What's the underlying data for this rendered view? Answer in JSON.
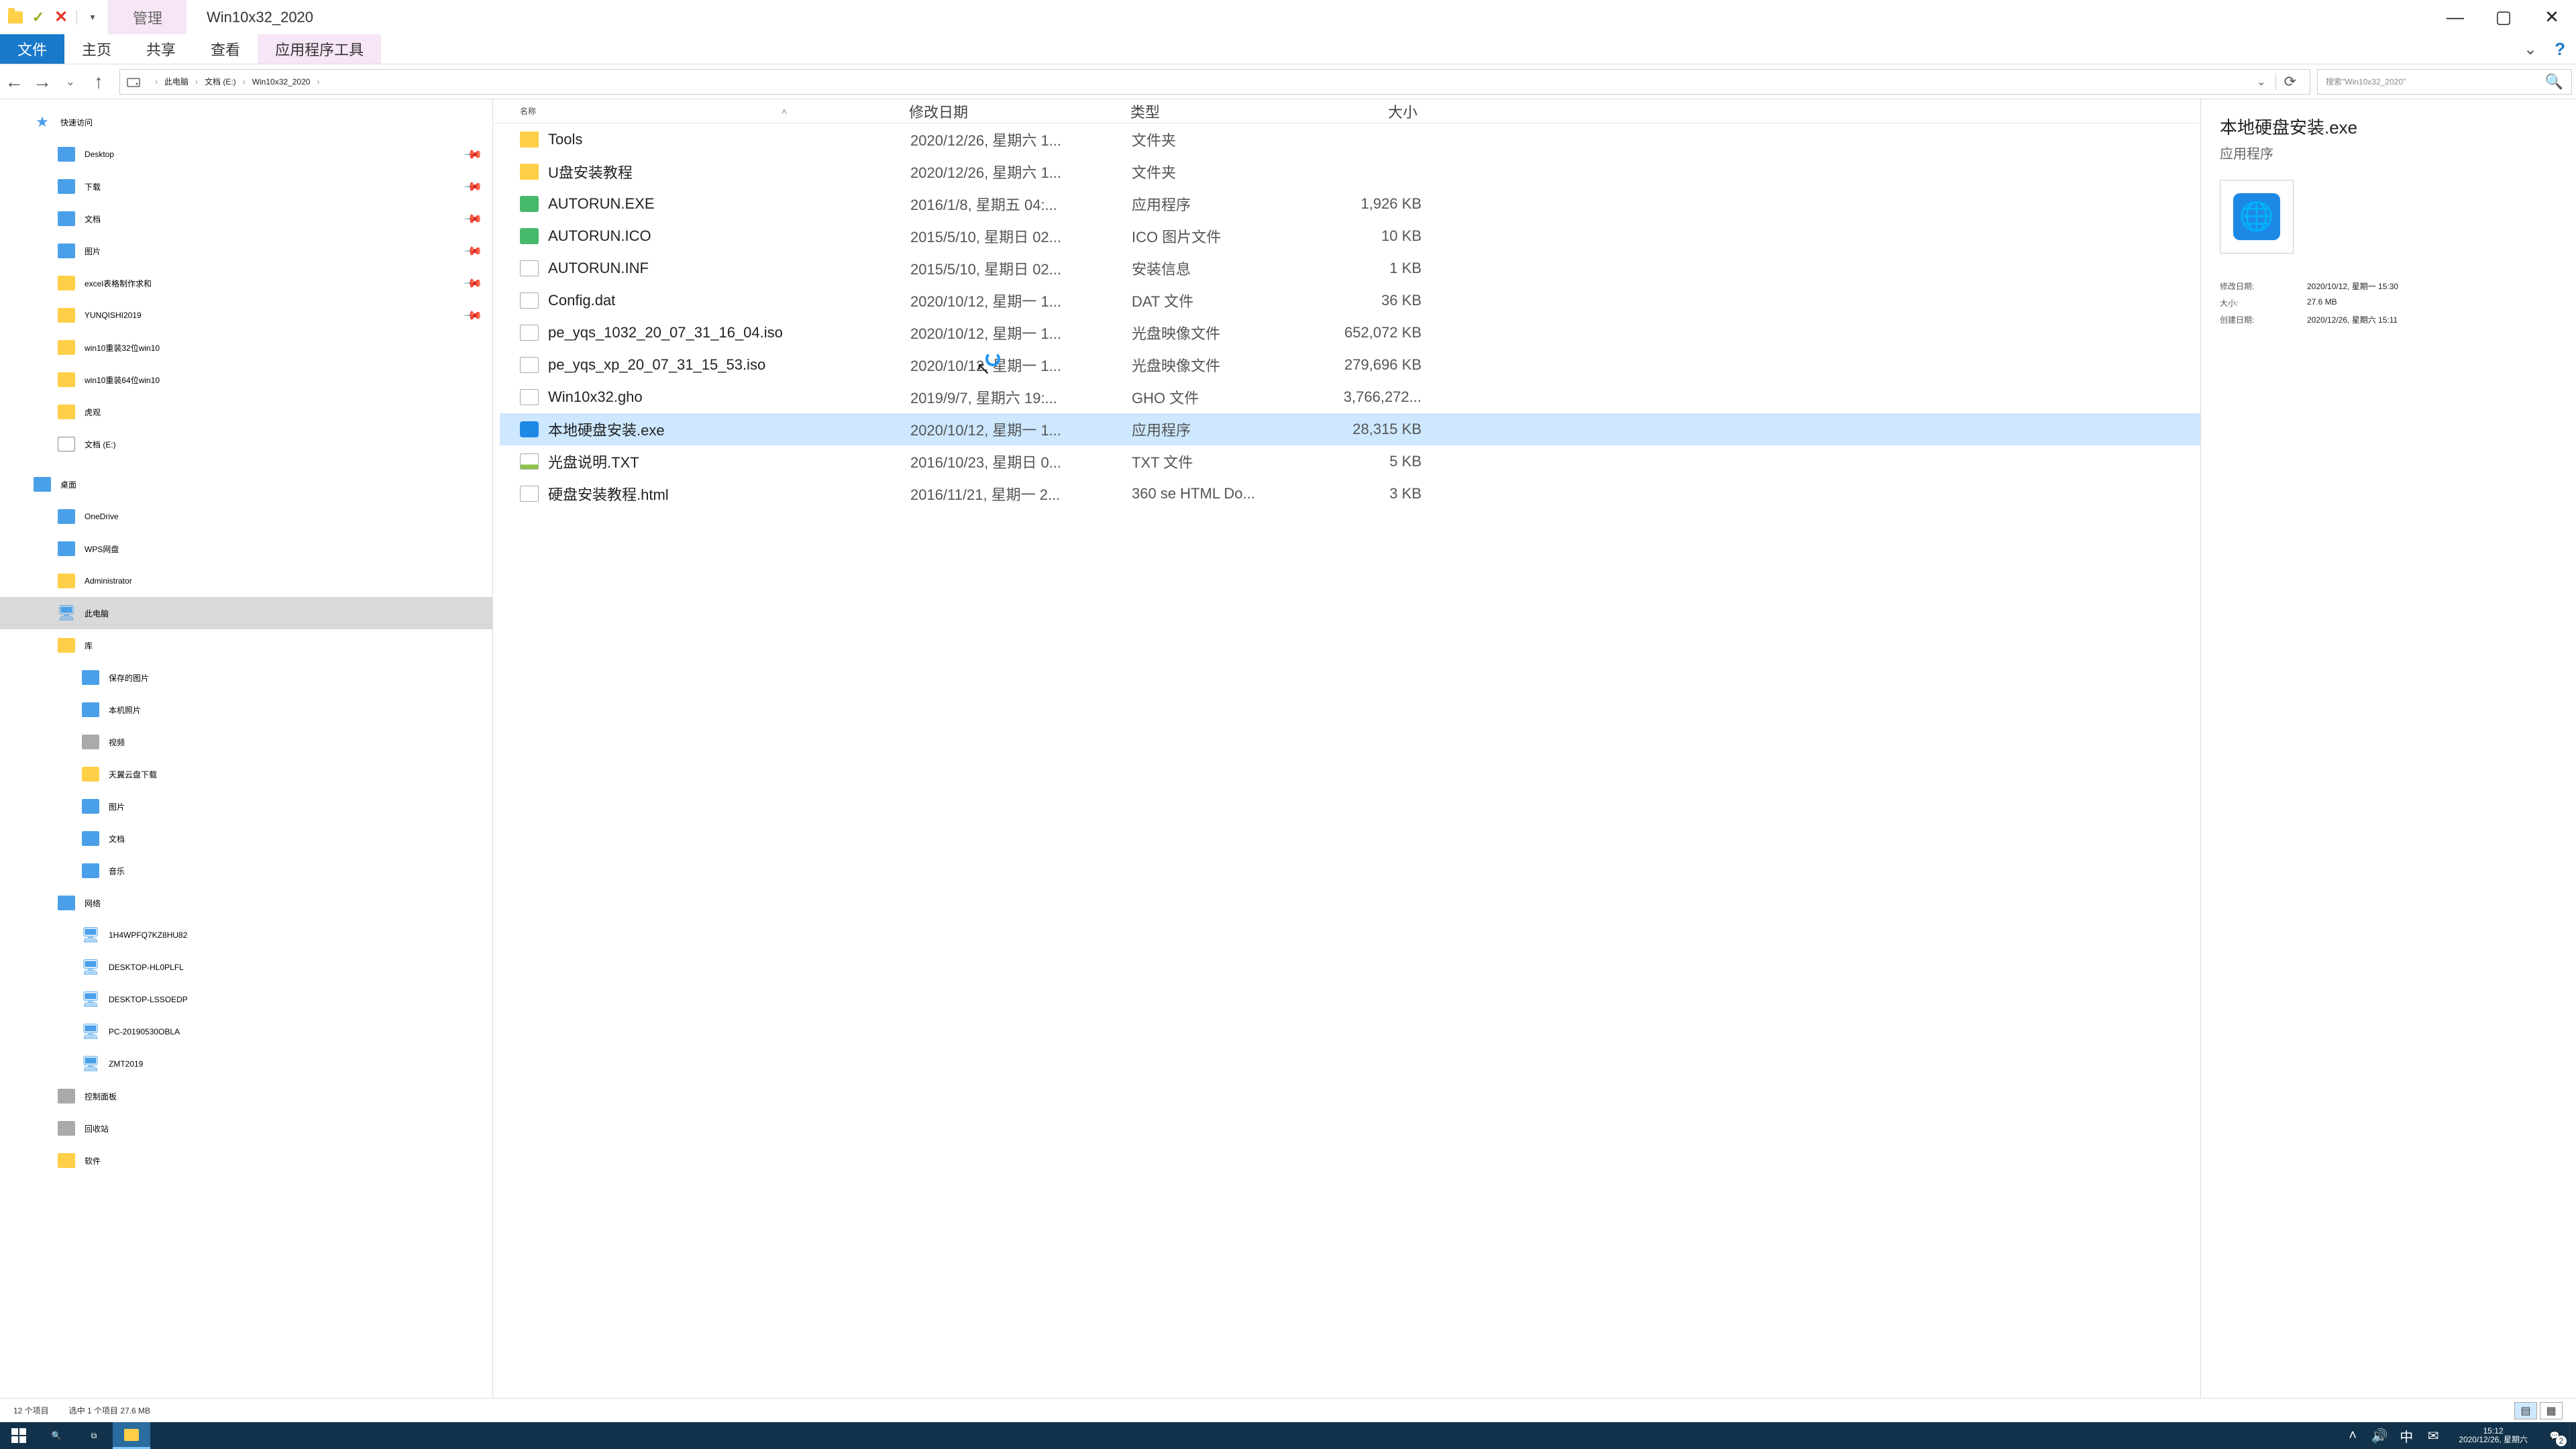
{
  "window": {
    "manage_label": "管理",
    "title": "Win10x32_2020"
  },
  "ribbon": {
    "file": "文件",
    "home": "主页",
    "share": "共享",
    "view": "查看",
    "app_tools": "应用程序工具"
  },
  "breadcrumbs": [
    "此电脑",
    "文档 (E:)",
    "Win10x32_2020"
  ],
  "search_placeholder": "搜索\"Win10x32_2020\"",
  "nav_tree": [
    {
      "label": "快速访问",
      "icon": "star",
      "indent": 0
    },
    {
      "label": "Desktop",
      "icon": "blue",
      "indent": 1,
      "pinned": true
    },
    {
      "label": "下载",
      "icon": "blue",
      "indent": 1,
      "pinned": true
    },
    {
      "label": "文档",
      "icon": "blue",
      "indent": 1,
      "pinned": true
    },
    {
      "label": "图片",
      "icon": "blue",
      "indent": 1,
      "pinned": true
    },
    {
      "label": "excel表格制作求和",
      "icon": "folder",
      "indent": 1,
      "pinned": true
    },
    {
      "label": "YUNQISHI2019",
      "icon": "folder",
      "indent": 1,
      "pinned": true
    },
    {
      "label": "win10重装32位win10",
      "icon": "folder",
      "indent": 1
    },
    {
      "label": "win10重装64位win10",
      "icon": "folder",
      "indent": 1
    },
    {
      "label": "虎观",
      "icon": "folder",
      "indent": 1
    },
    {
      "label": "文档 (E:)",
      "icon": "drv",
      "indent": 1
    },
    {
      "spacer": true
    },
    {
      "label": "桌面",
      "icon": "blue",
      "indent": 0
    },
    {
      "label": "OneDrive",
      "icon": "blue",
      "indent": 1
    },
    {
      "label": "WPS网盘",
      "icon": "blue",
      "indent": 1
    },
    {
      "label": "Administrator",
      "icon": "folder",
      "indent": 1
    },
    {
      "label": "此电脑",
      "icon": "pc",
      "indent": 1,
      "selected": true
    },
    {
      "label": "库",
      "icon": "folder",
      "indent": 1
    },
    {
      "label": "保存的图片",
      "icon": "blue",
      "indent": 2
    },
    {
      "label": "本机照片",
      "icon": "blue",
      "indent": 2
    },
    {
      "label": "视频",
      "icon": "gray",
      "indent": 2
    },
    {
      "label": "天翼云盘下载",
      "icon": "folder",
      "indent": 2
    },
    {
      "label": "图片",
      "icon": "blue",
      "indent": 2
    },
    {
      "label": "文档",
      "icon": "blue",
      "indent": 2
    },
    {
      "label": "音乐",
      "icon": "blue",
      "indent": 2
    },
    {
      "label": "网络",
      "icon": "blue",
      "indent": 1
    },
    {
      "label": "1H4WPFQ7KZ8HU82",
      "icon": "pc",
      "indent": 2
    },
    {
      "label": "DESKTOP-HL0PLFL",
      "icon": "pc",
      "indent": 2
    },
    {
      "label": "DESKTOP-LSSOEDP",
      "icon": "pc",
      "indent": 2
    },
    {
      "label": "PC-20190530OBLA",
      "icon": "pc",
      "indent": 2
    },
    {
      "label": "ZMT2019",
      "icon": "pc",
      "indent": 2
    },
    {
      "label": "控制面板",
      "icon": "gray",
      "indent": 1
    },
    {
      "label": "回收站",
      "icon": "gray",
      "indent": 1
    },
    {
      "label": "软件",
      "icon": "folder",
      "indent": 1
    }
  ],
  "columns": {
    "name": "名称",
    "date": "修改日期",
    "type": "类型",
    "size": "大小"
  },
  "rows": [
    {
      "ico": "folder",
      "name": "Tools",
      "date": "2020/12/26, 星期六 1...",
      "type": "文件夹",
      "size": ""
    },
    {
      "ico": "folder",
      "name": "U盘安装教程",
      "date": "2020/12/26, 星期六 1...",
      "type": "文件夹",
      "size": ""
    },
    {
      "ico": "app2",
      "name": "AUTORUN.EXE",
      "date": "2016/1/8, 星期五 04:...",
      "type": "应用程序",
      "size": "1,926 KB"
    },
    {
      "ico": "app2",
      "name": "AUTORUN.ICO",
      "date": "2015/5/10, 星期日 02...",
      "type": "ICO 图片文件",
      "size": "10 KB"
    },
    {
      "ico": "file",
      "name": "AUTORUN.INF",
      "date": "2015/5/10, 星期日 02...",
      "type": "安装信息",
      "size": "1 KB"
    },
    {
      "ico": "file",
      "name": "Config.dat",
      "date": "2020/10/12, 星期一 1...",
      "type": "DAT 文件",
      "size": "36 KB"
    },
    {
      "ico": "file",
      "name": "pe_yqs_1032_20_07_31_16_04.iso",
      "date": "2020/10/12, 星期一 1...",
      "type": "光盘映像文件",
      "size": "652,072 KB"
    },
    {
      "ico": "file",
      "name": "pe_yqs_xp_20_07_31_15_53.iso",
      "date": "2020/10/12, 星期一 1...",
      "type": "光盘映像文件",
      "size": "279,696 KB"
    },
    {
      "ico": "file",
      "name": "Win10x32.gho",
      "date": "2019/9/7, 星期六 19:...",
      "type": "GHO 文件",
      "size": "3,766,272..."
    },
    {
      "ico": "sel-ico",
      "name": "本地硬盘安装.exe",
      "date": "2020/10/12, 星期一 1...",
      "type": "应用程序",
      "size": "28,315 KB",
      "selected": true
    },
    {
      "ico": "txt",
      "name": "光盘说明.TXT",
      "date": "2016/10/23, 星期日 0...",
      "type": "TXT 文件",
      "size": "5 KB"
    },
    {
      "ico": "file",
      "name": "硬盘安装教程.html",
      "date": "2016/11/21, 星期一 2...",
      "type": "360 se HTML Do...",
      "size": "3 KB"
    }
  ],
  "details": {
    "title": "本地硬盘安装.exe",
    "subtype": "应用程序",
    "modified_k": "修改日期:",
    "modified_v": "2020/10/12, 星期一 15:30",
    "size_k": "大小:",
    "size_v": "27.6 MB",
    "created_k": "创建日期:",
    "created_v": "2020/12/26, 星期六 15:11"
  },
  "status": {
    "items": "12 个项目",
    "selected": "选中 1 个项目  27.6 MB"
  },
  "taskbar": {
    "time": "15:12",
    "date": "2020/12/26, 星期六",
    "ime": "中",
    "notif_count": "2"
  }
}
